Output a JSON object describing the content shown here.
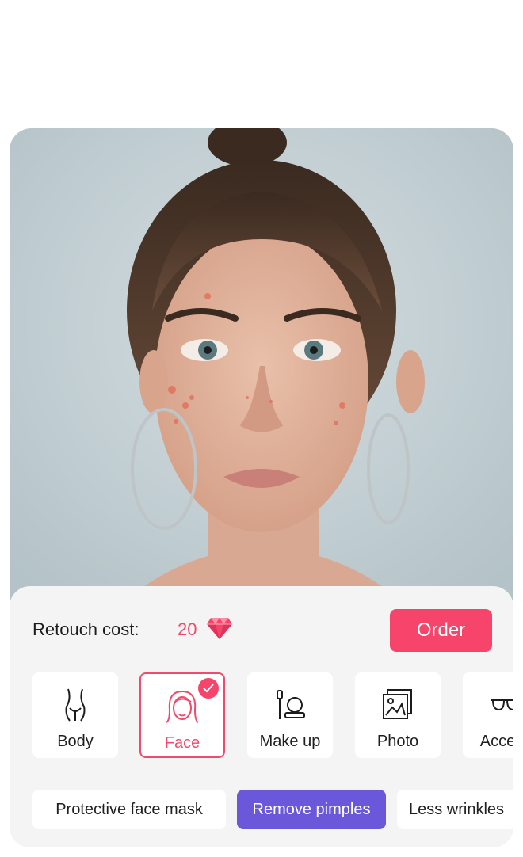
{
  "photo": {
    "description_icon": "portrait-photo"
  },
  "cost": {
    "label": "Retouch cost:",
    "value": "20",
    "icon": "gem-icon"
  },
  "order": {
    "label": "Order"
  },
  "categories": [
    {
      "label": "Body",
      "icon": "body-icon",
      "selected": false
    },
    {
      "label": "Face",
      "icon": "face-icon",
      "selected": true
    },
    {
      "label": "Make up",
      "icon": "makeup-icon",
      "selected": false
    },
    {
      "label": "Photo",
      "icon": "photo-icon",
      "selected": false
    },
    {
      "label": "Access",
      "icon": "sunglasses-icon",
      "selected": false
    }
  ],
  "options": [
    {
      "label": "Protective face mask",
      "active": false
    },
    {
      "label": "Remove pimples",
      "active": true
    },
    {
      "label": "Less wrinkles",
      "active": false
    }
  ],
  "colors": {
    "accent": "#f7446a",
    "chip_active": "#6b57d9",
    "panel": "#f4f4f4"
  }
}
